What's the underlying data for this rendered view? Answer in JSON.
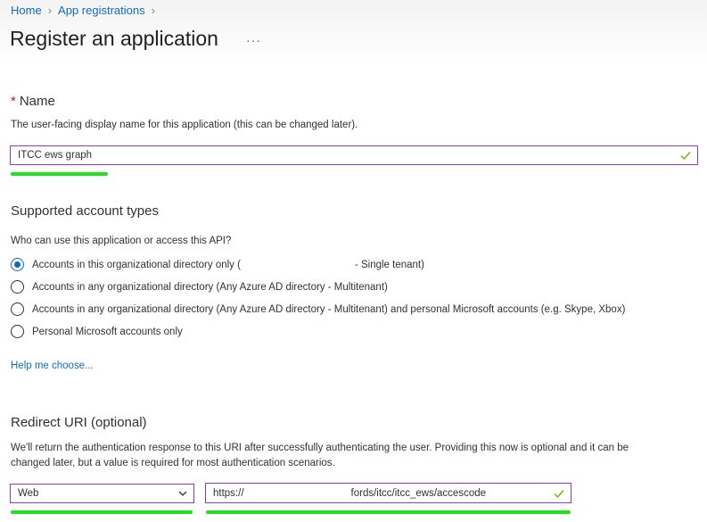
{
  "breadcrumb": {
    "items": [
      "Home",
      "App registrations"
    ]
  },
  "header": {
    "title": "Register an application",
    "more": "···"
  },
  "name": {
    "required_marker": "*",
    "label": "Name",
    "description": "The user-facing display name for this application (this can be changed later).",
    "value": "ITCC ews graph"
  },
  "account_types": {
    "label": "Supported account types",
    "question": "Who can use this application or access this API?",
    "options": [
      {
        "label_start": "Accounts in this organizational directory only (",
        "label_end": " - Single tenant)",
        "checked": true
      },
      {
        "label": "Accounts in any organizational directory (Any Azure AD directory - Multitenant)",
        "checked": false
      },
      {
        "label": "Accounts in any organizational directory (Any Azure AD directory - Multitenant) and personal Microsoft accounts (e.g. Skype, Xbox)",
        "checked": false
      },
      {
        "label": "Personal Microsoft accounts only",
        "checked": false
      }
    ],
    "help_link": "Help me choose..."
  },
  "redirect": {
    "label": "Redirect URI (optional)",
    "description_line1": "We'll return the authentication response to this URI after successfully authenticating the user. Providing this now is optional and it can be",
    "description_line2": "changed later, but a value is required for most authentication scenarios.",
    "platform": "Web",
    "uri_prefix": "https://",
    "uri_suffix": "fords/itcc/itcc_ews/accescode"
  },
  "colors": {
    "accent": "#0f6cbd",
    "focus_border": "#8a3bc9",
    "valid_check": "#6bb700",
    "highlight": "#1ee31e",
    "required": "#a4262c"
  }
}
